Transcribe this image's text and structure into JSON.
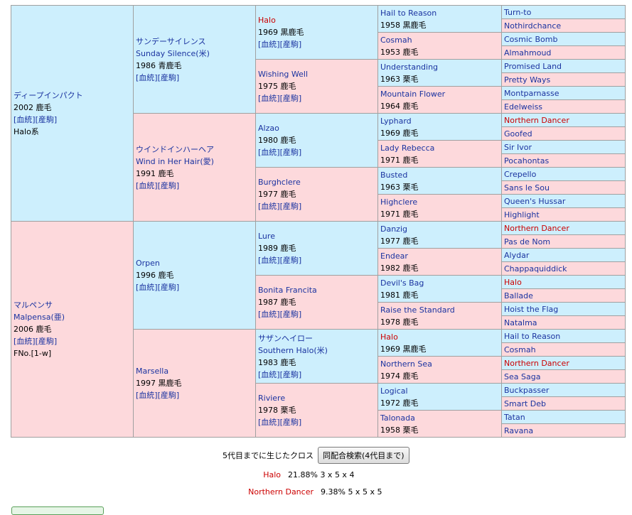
{
  "g1": [
    {
      "name_jp": "ディープインパクト",
      "line2": "2002 鹿毛",
      "links": "[血統][産駒]",
      "extra": "Halo系",
      "sex": "m"
    },
    {
      "name_jp": "マルペンサ",
      "name_en": "Malpensa(亜)",
      "line2": "2006 鹿毛",
      "links": "[血統][産駒]",
      "extra": "FNo.[1-w]",
      "sex": "f"
    }
  ],
  "g2": [
    {
      "name_jp": "サンデーサイレンス",
      "name_en": "Sunday Silence(米)",
      "line2": "1986 青鹿毛",
      "links": "[血統][産駒]",
      "sex": "m"
    },
    {
      "name_jp": "ウインドインハーヘア",
      "name_en": "Wind in Her Hair(愛)",
      "line2": "1991 鹿毛",
      "links": "[血統][産駒]",
      "sex": "f"
    },
    {
      "name_jp": "Orpen",
      "line2": "1996 鹿毛",
      "links": "[血統][産駒]",
      "sex": "m"
    },
    {
      "name_jp": "Marsella",
      "line2": "1997 黒鹿毛",
      "links": "[血統][産駒]",
      "sex": "f"
    }
  ],
  "g3": [
    {
      "name": "Halo",
      "line2": "1969 黒鹿毛",
      "links": "[血統][産駒]",
      "sex": "m",
      "red": true
    },
    {
      "name": "Wishing Well",
      "line2": "1975 鹿毛",
      "links": "[血統][産駒]",
      "sex": "f"
    },
    {
      "name": "Alzao",
      "line2": "1980 鹿毛",
      "links": "[血統][産駒]",
      "sex": "m"
    },
    {
      "name": "Burghclere",
      "line2": "1977 鹿毛",
      "links": "[血統][産駒]",
      "sex": "f"
    },
    {
      "name": "Lure",
      "line2": "1989 鹿毛",
      "links": "[血統][産駒]",
      "sex": "m"
    },
    {
      "name": "Bonita Francita",
      "line2": "1987 鹿毛",
      "links": "[血統][産駒]",
      "sex": "f"
    },
    {
      "name": "サザンヘイロー",
      "name_en": "Southern Halo(米)",
      "line2": "1983 鹿毛",
      "links": "[血統][産駒]",
      "sex": "m"
    },
    {
      "name": "Riviere",
      "line2": "1978 栗毛",
      "links": "[血統][産駒]",
      "sex": "f"
    }
  ],
  "g4": [
    {
      "name": "Hail to Reason",
      "line2": "1958 黒鹿毛",
      "sex": "m"
    },
    {
      "name": "Cosmah",
      "line2": "1953 鹿毛",
      "sex": "f"
    },
    {
      "name": "Understanding",
      "line2": "1963 栗毛",
      "sex": "m"
    },
    {
      "name": "Mountain Flower",
      "line2": "1964 鹿毛",
      "sex": "f"
    },
    {
      "name": "Lyphard",
      "line2": "1969 鹿毛",
      "sex": "m"
    },
    {
      "name": "Lady Rebecca",
      "line2": "1971 鹿毛",
      "sex": "f"
    },
    {
      "name": "Busted",
      "line2": "1963 栗毛",
      "sex": "m"
    },
    {
      "name": "Highclere",
      "line2": "1971 鹿毛",
      "sex": "f"
    },
    {
      "name": "Danzig",
      "line2": "1977 鹿毛",
      "sex": "m"
    },
    {
      "name": "Endear",
      "line2": "1982 鹿毛",
      "sex": "f"
    },
    {
      "name": "Devil's Bag",
      "line2": "1981 鹿毛",
      "sex": "m"
    },
    {
      "name": "Raise the Standard",
      "line2": "1978 鹿毛",
      "sex": "f"
    },
    {
      "name": "Halo",
      "line2": "1969 黒鹿毛",
      "sex": "m",
      "red": true
    },
    {
      "name": "Northern Sea",
      "line2": "1974 鹿毛",
      "sex": "f"
    },
    {
      "name": "Logical",
      "line2": "1972 鹿毛",
      "sex": "m"
    },
    {
      "name": "Talonada",
      "line2": "1958 栗毛",
      "sex": "f"
    }
  ],
  "g5": [
    {
      "name": "Turn-to",
      "sex": "m"
    },
    {
      "name": "Nothirdchance",
      "sex": "f"
    },
    {
      "name": "Cosmic Bomb",
      "sex": "m"
    },
    {
      "name": "Almahmoud",
      "sex": "f"
    },
    {
      "name": "Promised Land",
      "sex": "m"
    },
    {
      "name": "Pretty Ways",
      "sex": "f"
    },
    {
      "name": "Montparnasse",
      "sex": "m"
    },
    {
      "name": "Edelweiss",
      "sex": "f"
    },
    {
      "name": "Northern Dancer",
      "sex": "m",
      "red": true
    },
    {
      "name": "Goofed",
      "sex": "f"
    },
    {
      "name": "Sir Ivor",
      "sex": "m"
    },
    {
      "name": "Pocahontas",
      "sex": "f"
    },
    {
      "name": "Crepello",
      "sex": "m"
    },
    {
      "name": "Sans le Sou",
      "sex": "f"
    },
    {
      "name": "Queen's Hussar",
      "sex": "m"
    },
    {
      "name": "Highlight",
      "sex": "f"
    },
    {
      "name": "Northern Dancer",
      "sex": "m",
      "red": true
    },
    {
      "name": "Pas de Nom",
      "sex": "f"
    },
    {
      "name": "Alydar",
      "sex": "m"
    },
    {
      "name": "Chappaquiddick",
      "sex": "f"
    },
    {
      "name": "Halo",
      "sex": "m",
      "red": true
    },
    {
      "name": "Ballade",
      "sex": "f"
    },
    {
      "name": "Hoist the Flag",
      "sex": "m"
    },
    {
      "name": "Natalma",
      "sex": "f"
    },
    {
      "name": "Hail to Reason",
      "sex": "m"
    },
    {
      "name": "Cosmah",
      "sex": "f"
    },
    {
      "name": "Northern Dancer",
      "sex": "m",
      "red": true
    },
    {
      "name": "Sea Saga",
      "sex": "f"
    },
    {
      "name": "Buckpasser",
      "sex": "m"
    },
    {
      "name": "Smart Deb",
      "sex": "f"
    },
    {
      "name": "Tatan",
      "sex": "m"
    },
    {
      "name": "Ravana",
      "sex": "f"
    }
  ],
  "cross": {
    "label": "5代目までに生じたクロス",
    "button": "同配合検索(4代目まで)",
    "rows": [
      {
        "name": "Halo",
        "value": "21.88%  3 x 5 x 4"
      },
      {
        "name": "Northern Dancer",
        "value": "9.38%  5 x 5 x 5"
      }
    ]
  }
}
